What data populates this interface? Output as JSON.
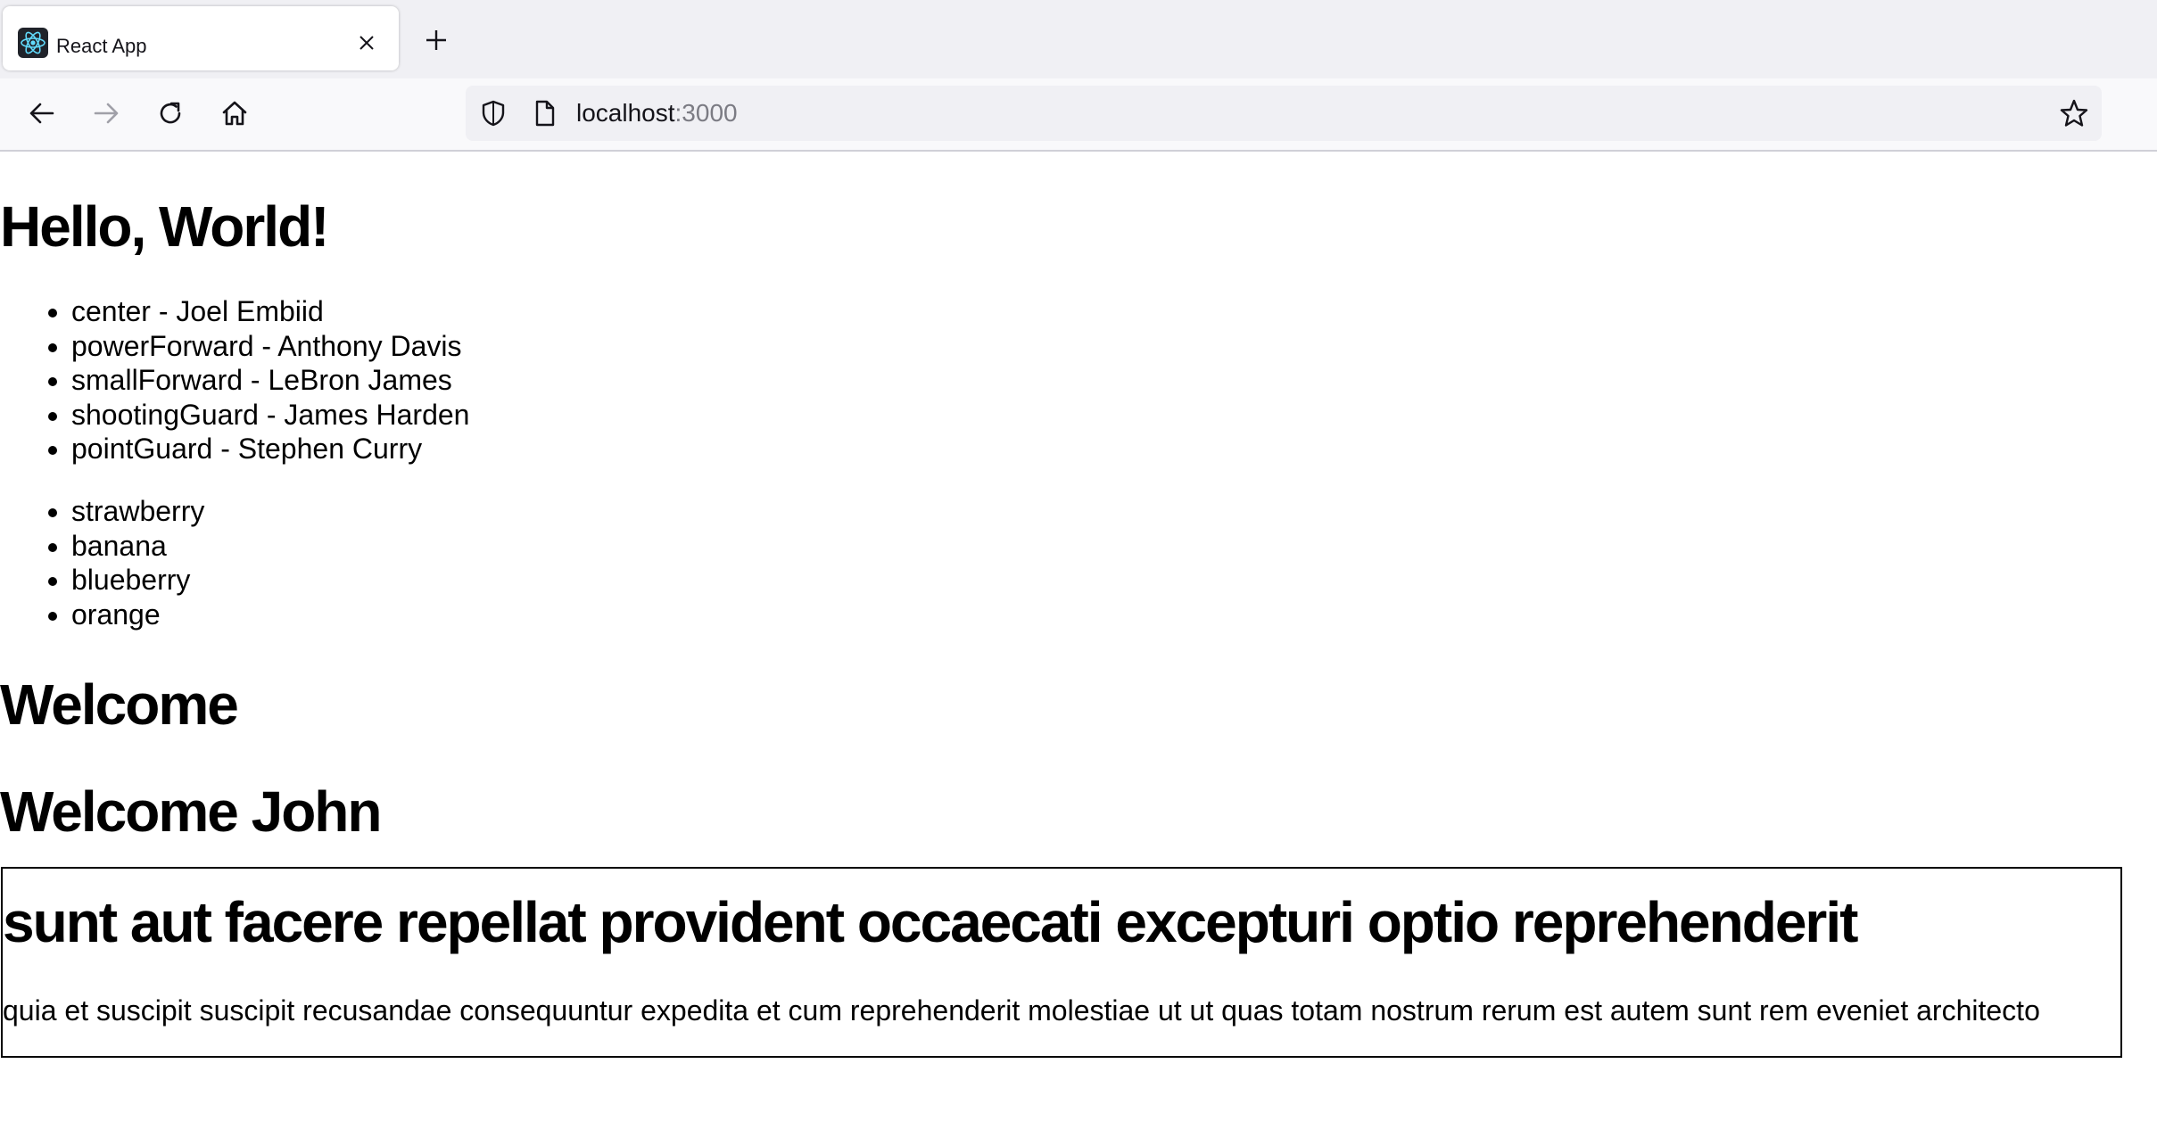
{
  "browser": {
    "tab": {
      "title": "React App",
      "favicon": "react-logo-icon"
    },
    "url": {
      "host": "localhost",
      "port": ":3000"
    },
    "icons": {
      "back": "arrow-left-icon",
      "forward": "arrow-right-icon",
      "reload": "reload-icon",
      "home": "home-icon",
      "shield": "shield-icon",
      "page": "page-icon",
      "bookmark": "star-icon",
      "close_tab": "close-icon",
      "new_tab": "plus-icon"
    }
  },
  "page": {
    "heading": "Hello, World!",
    "players": [
      "center - Joel Embiid",
      "powerForward - Anthony Davis",
      "smallForward - LeBron James",
      "shootingGuard - James Harden",
      "pointGuard - Stephen Curry"
    ],
    "fruits": [
      "strawberry",
      "banana",
      "blueberry",
      "orange"
    ],
    "welcome": "Welcome",
    "welcome_user": "Welcome John",
    "post": {
      "title": "sunt aut facere repellat provident occaecati excepturi optio reprehenderit",
      "body": "quia et suscipit suscipit recusandae consequuntur expedita et cum reprehenderit molestiae ut ut quas totam nostrum rerum est autem sunt rem eveniet architecto"
    }
  },
  "colors": {
    "tabbar_bg": "#f0f0f4",
    "toolbar_bg": "#f9f9fb",
    "urlbar_bg": "#f0f0f4",
    "react_blue": "#61dafb",
    "text": "#000000"
  }
}
